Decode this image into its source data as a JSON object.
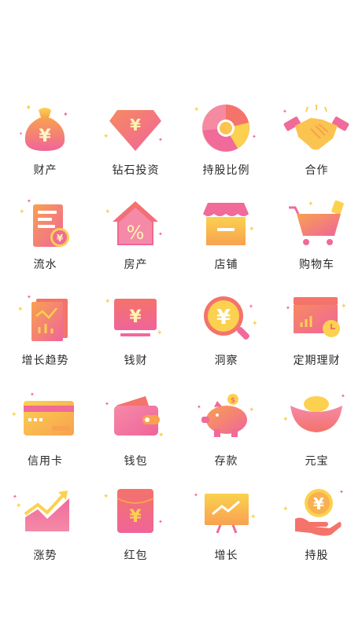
{
  "colors": {
    "pink": "#f0649a",
    "coral": "#f4736a",
    "orange": "#f8a150",
    "yellow": "#fbd14f",
    "label": "#2a2a2a"
  },
  "icons": [
    {
      "label": "财产",
      "icon": "money-bag-icon"
    },
    {
      "label": "钻石投资",
      "icon": "diamond-icon"
    },
    {
      "label": "持股比例",
      "icon": "pie-chart-icon"
    },
    {
      "label": "合作",
      "icon": "handshake-icon"
    },
    {
      "label": "流水",
      "icon": "statement-icon"
    },
    {
      "label": "房产",
      "icon": "house-icon"
    },
    {
      "label": "店铺",
      "icon": "shop-icon"
    },
    {
      "label": "购物车",
      "icon": "cart-icon"
    },
    {
      "label": "增长趋势",
      "icon": "trend-chart-icon"
    },
    {
      "label": "钱财",
      "icon": "money-screen-icon"
    },
    {
      "label": "洞察",
      "icon": "magnifier-icon"
    },
    {
      "label": "定期理财",
      "icon": "timed-finance-icon"
    },
    {
      "label": "信用卡",
      "icon": "credit-card-icon"
    },
    {
      "label": "钱包",
      "icon": "wallet-icon"
    },
    {
      "label": "存款",
      "icon": "piggy-bank-icon"
    },
    {
      "label": "元宝",
      "icon": "gold-ingot-icon"
    },
    {
      "label": "涨势",
      "icon": "rising-arrow-icon"
    },
    {
      "label": "红包",
      "icon": "red-envelope-icon"
    },
    {
      "label": "增长",
      "icon": "growth-board-icon"
    },
    {
      "label": "持股",
      "icon": "coin-hand-icon"
    }
  ]
}
